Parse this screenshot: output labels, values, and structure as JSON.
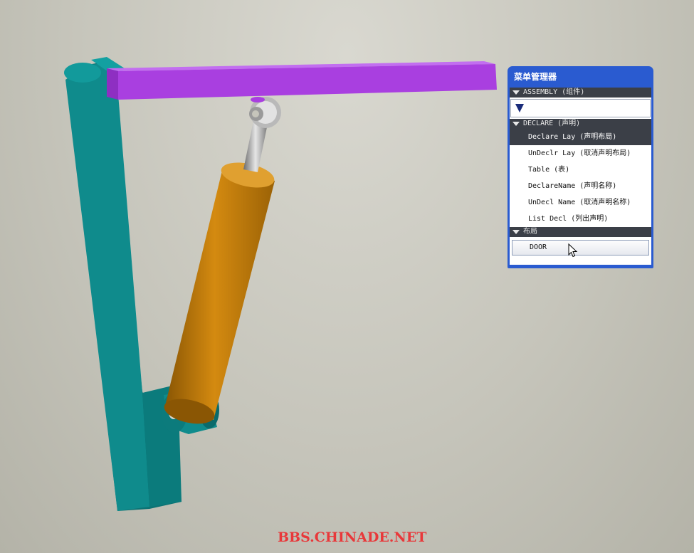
{
  "menu_manager": {
    "title": "菜单管理器",
    "sections": {
      "assembly": {
        "label": "ASSEMBLY (组件)"
      },
      "declare": {
        "label": "DECLARE (声明)",
        "items": [
          "Declare Lay (声明布局)",
          "UnDeclr Lay (取消声明布局)",
          "Table (表)",
          "DeclareName (声明名称)",
          "UnDecl Name (取消声明名称)",
          "List Decl (列出声明)"
        ],
        "selected_index": 0
      },
      "layout": {
        "label": "布局",
        "button": "DOOR"
      }
    }
  },
  "watermark": "BBS.CHINADE.NET",
  "colors": {
    "beam": "#a93fe0",
    "frame": "#0f8b8c",
    "cylinder": "#c47d0a",
    "rod": "#9a9a9a",
    "menu_border": "#2a5bd0",
    "section_header": "#3b3f47",
    "watermark": "#e8383a"
  }
}
